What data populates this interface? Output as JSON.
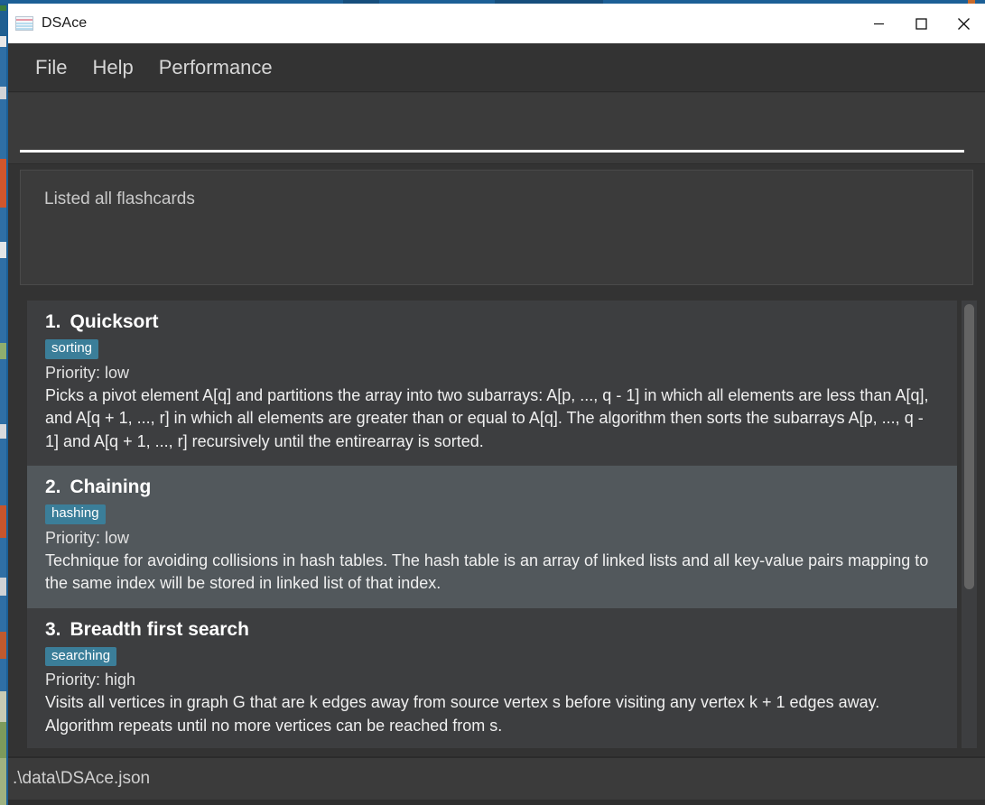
{
  "window": {
    "title": "DSAce",
    "icon": "flashcard-icon",
    "controls": {
      "minimize": "minimize-icon",
      "maximize": "maximize-icon",
      "close": "close-icon"
    }
  },
  "menubar": {
    "items": [
      {
        "label": "File"
      },
      {
        "label": "Help"
      },
      {
        "label": "Performance"
      }
    ]
  },
  "command_input": {
    "value": "",
    "placeholder": ""
  },
  "message_panel": {
    "text": "Listed all flashcards"
  },
  "cards": [
    {
      "number": "1.",
      "title": "Quicksort",
      "tag": "sorting",
      "priority": "Priority: low",
      "description": "Picks a pivot element A[q] and partitions the array into two subarrays: A[p, ..., q - 1] in which all elements are less than A[q], and A[q + 1, ..., r] in which all elements are greater than or equal to A[q]. The algorithm then sorts the subarrays A[p, ..., q - 1] and A[q + 1, ..., r] recursively until the entirearray is sorted."
    },
    {
      "number": "2.",
      "title": "Chaining",
      "tag": "hashing",
      "priority": "Priority: low",
      "description": "Technique for avoiding collisions in hash tables. The hash table is an array of linked lists and all key-value pairs mapping to the same index will be stored in linked list  of that index."
    },
    {
      "number": "3.",
      "title": "Breadth first search",
      "tag": "searching",
      "priority": "Priority: high",
      "description": "Visits all vertices in graph G that are k edges away from source vertex s before visiting any vertex k + 1 edges away. Algorithm repeats until no more vertices can be reached from s."
    }
  ],
  "statusbar": {
    "path": ".\\data\\DSAce.json"
  },
  "colors": {
    "accent_badge": "#3b7e99",
    "window_background": "#2e2e2e",
    "panel_background": "#333333",
    "row_background": "#3d3e40",
    "row_selected_background": "#52585c",
    "titlebar_background": "#ffffff",
    "input_underline": "#ffffff"
  }
}
